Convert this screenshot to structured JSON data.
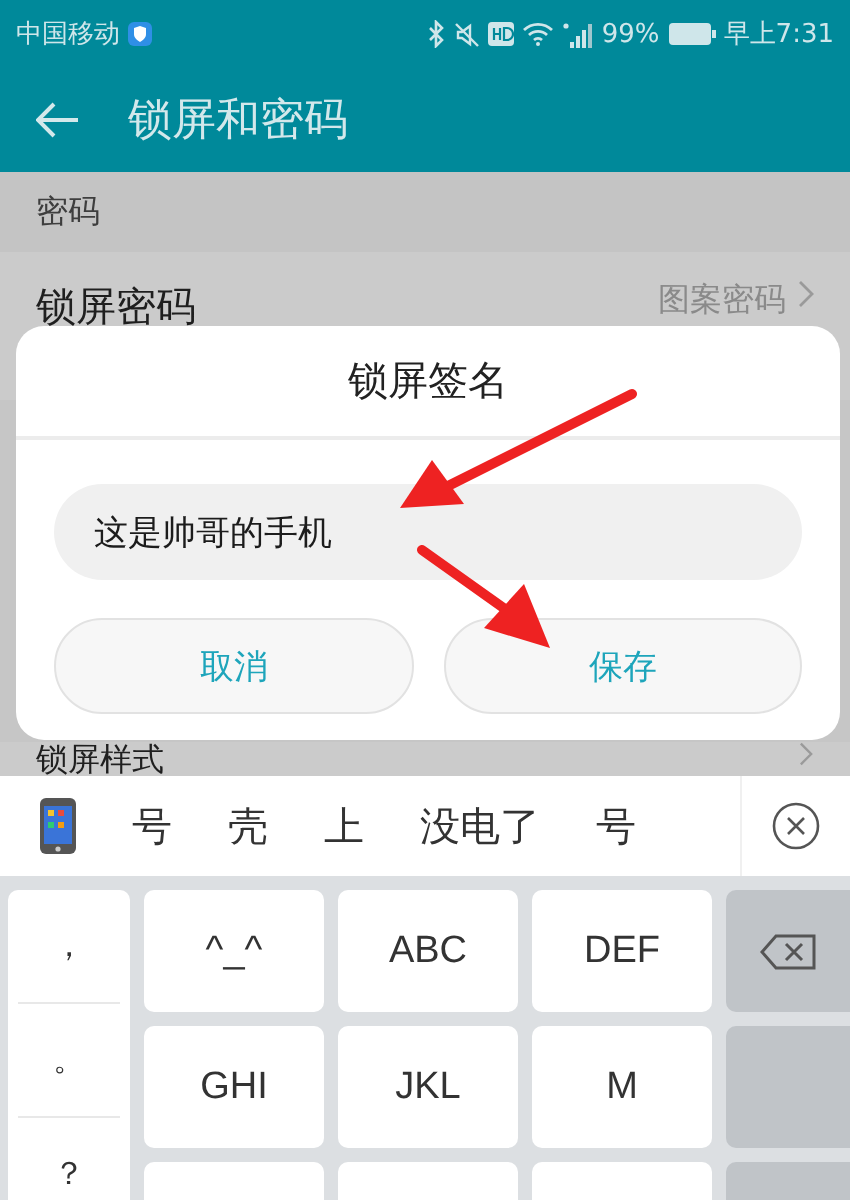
{
  "status_bar": {
    "carrier": "中国移动",
    "battery": "99%",
    "time": "早上7:31"
  },
  "header": {
    "title": "锁屏和密码"
  },
  "section": {
    "title": "密码"
  },
  "rows": [
    {
      "label": "锁屏密码",
      "value": "图案密码"
    },
    {
      "label": "锁屏样式"
    }
  ],
  "dialog": {
    "title": "锁屏签名",
    "input": {
      "value": "这是帅哥的手机"
    },
    "buttons": [
      {
        "label": "取消"
      },
      {
        "label": "保存"
      }
    ]
  },
  "keyboard": {
    "candidates": [
      "号",
      "壳",
      "上",
      "没电了",
      "号"
    ],
    "symbols": [
      "，",
      "。",
      "？"
    ],
    "keys": [
      [
        "^_^",
        "ABC",
        "DEF"
      ],
      [
        "GHI",
        "JKL",
        "M"
      ]
    ]
  }
}
